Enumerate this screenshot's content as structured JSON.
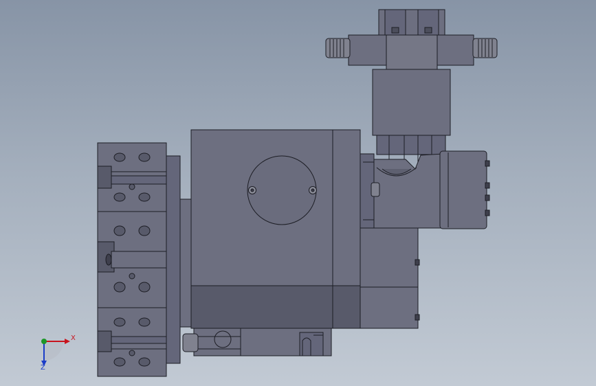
{
  "viewport": {
    "background_top": "#8794a6",
    "background_bottom": "#c2cad4"
  },
  "model": {
    "face_color": "#6d6f80",
    "face_light": "#80828f",
    "face_dark": "#585a6a",
    "edge_color": "#1c1d24"
  },
  "triad": {
    "x_label": "X",
    "z_label": "Z",
    "x_color": "#c8141e",
    "y_color": "#1e9628",
    "z_color": "#1a3cc8"
  }
}
